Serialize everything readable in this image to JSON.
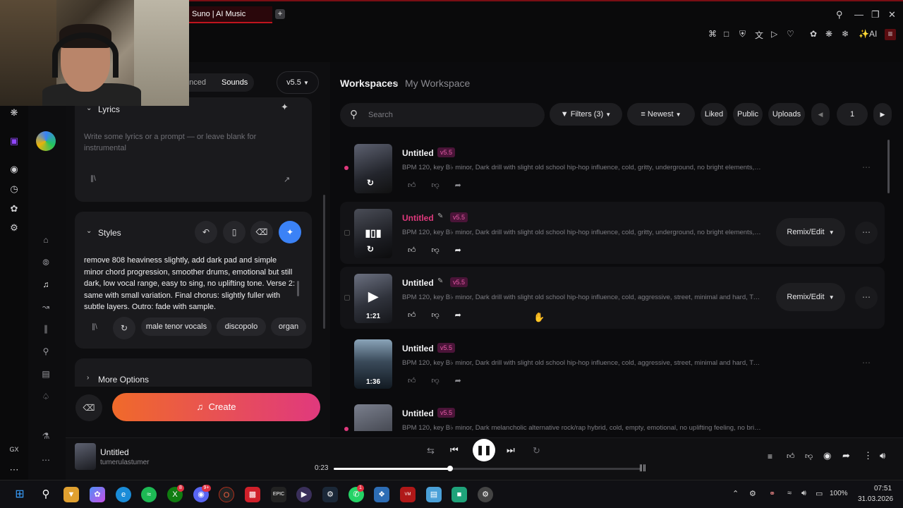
{
  "browser": {
    "tab_title": "Suno | AI Music",
    "new_tab": "+",
    "ext_ai_label": "AI"
  },
  "create": {
    "mode_tabs": [
      "Advanced",
      "Sounds"
    ],
    "mode_tab_visible_fragment": "anced",
    "model": "v5.5",
    "lyrics_label": "Lyrics",
    "lyrics_placeholder": "Write some lyrics or a prompt — or leave blank for instrumental",
    "styles_label": "Styles",
    "styles_text": "remove 808 heaviness slightly, add dark pad and simple minor chord progression, smoother drums, emotional but still dark, low vocal range, easy to sing, no uplifting tone. Verse 2: same with small variation. Final chorus: slightly fuller with subtle layers. Outro: fade with sample.",
    "style_tags": [
      "male tenor vocals",
      "discopolo",
      "organ"
    ],
    "more_options": "More Options",
    "create_button": "Create"
  },
  "workspace": {
    "breadcrumb_root": "Workspaces",
    "breadcrumb_current": "My Workspace",
    "search_placeholder": "Search",
    "filters_label": "Filters (3)",
    "sort_label": "Newest",
    "liked": "Liked",
    "public": "Public",
    "uploads": "Uploads",
    "page": "1",
    "remix_label": "Remix/Edit",
    "songs": [
      {
        "title": "Untitled",
        "version": "v5.5",
        "desc": "BPM 120, key B♭ minor, Dark drill with slight old school hip-hop influence, cold, gritty, underground, no bright elements, T...",
        "duration": "",
        "accent": false
      },
      {
        "title": "Untitled",
        "version": "v5.5",
        "desc": "BPM 120, key B♭ minor, Dark drill with slight old school hip-hop influence, cold, gritty, underground, no bright elements, T...",
        "duration": "",
        "accent": true
      },
      {
        "title": "Untitled",
        "version": "v5.5",
        "desc": "BPM 120, key B♭ minor, Dark drill with slight old school hip-hop influence, cold, aggressive, street, minimal and hard, Two r...",
        "duration": "1:21",
        "accent": false
      },
      {
        "title": "Untitled",
        "version": "v5.5",
        "desc": "BPM 120, key B♭ minor, Dark drill with slight old school hip-hop influence, cold, aggressive, street, minimal and hard, Two r...",
        "duration": "1:36",
        "accent": false
      },
      {
        "title": "Untitled",
        "version": "v5.5",
        "desc": "BPM 120, key B♭ minor, Dark melancholic alternative rock/rap hybrid, cold, empty, emotional, no uplifting feeling, no brigh...",
        "duration": "",
        "accent": false
      }
    ]
  },
  "player": {
    "title": "Untitled",
    "artist": "tumerulastumer",
    "elapsed": "0:23",
    "progress": 0.38
  },
  "taskbar": {
    "battery": "100%",
    "time": "07:51",
    "date": "31.03.2026",
    "xbox_badge": "8",
    "discord_badge": "9+",
    "whatsapp_badge": "1"
  },
  "sidebar": {
    "gx_label": "GX"
  },
  "colors": {
    "accent_pink": "#e0397d",
    "create_gradient": [
      "#f06a2a",
      "#e0397d"
    ],
    "browser_red": "#c0141e"
  }
}
